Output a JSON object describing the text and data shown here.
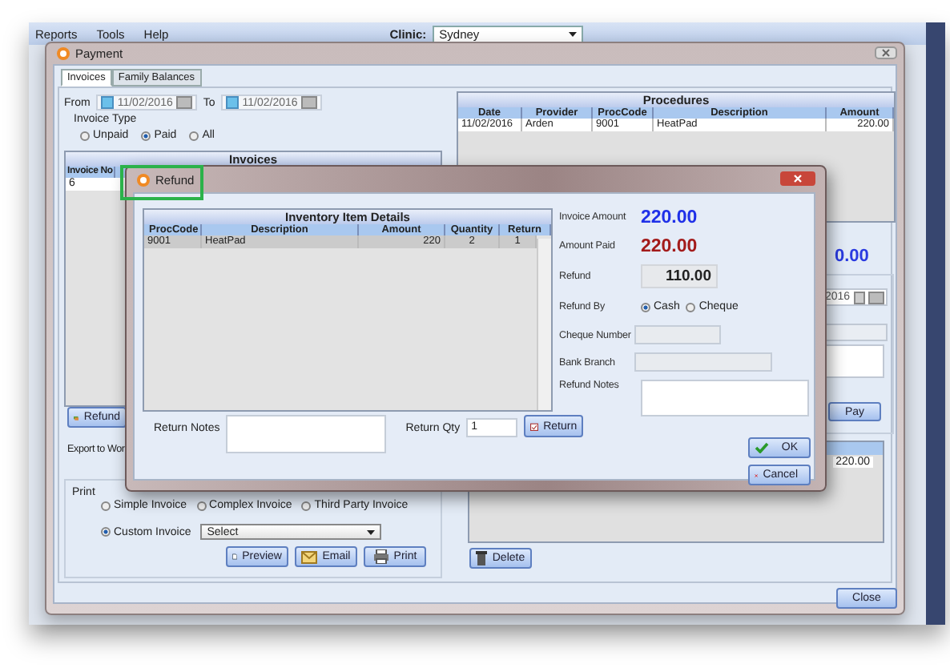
{
  "app": {
    "menu": [
      "Reports",
      "Tools",
      "Help"
    ],
    "clinic_label": "Clinic:",
    "clinic": "Sydney"
  },
  "payment": {
    "title": "Payment",
    "tabs": [
      {
        "label": "Invoices",
        "selected": true
      },
      {
        "label": "Family Balances",
        "selected": false
      }
    ],
    "from_label": "From",
    "from_date": "11/02/2016",
    "to_label": "To",
    "to_date": "11/02/2016",
    "invoice_type_label": "Invoice Type",
    "invoice_types": [
      {
        "label": "Unpaid",
        "selected": false
      },
      {
        "label": "Paid",
        "selected": true
      },
      {
        "label": "All",
        "selected": false
      }
    ],
    "invoices": {
      "title": "Invoices",
      "column": "Invoice No",
      "row": "6"
    },
    "refund_button": "Refund",
    "export_label": "Export to Wor",
    "print": {
      "label": "Print",
      "options": [
        {
          "label": "Simple Invoice",
          "selected": false
        },
        {
          "label": "Complex Invoice",
          "selected": false
        },
        {
          "label": "Third Party Invoice",
          "selected": false
        },
        {
          "label": "Custom Invoice",
          "selected": true
        }
      ],
      "template": "Select",
      "buttons": [
        "Preview",
        "Email",
        "Print"
      ]
    },
    "procedures": {
      "title": "Procedures",
      "columns": [
        "Date",
        "Provider",
        "ProcCode",
        "Description",
        "Amount"
      ],
      "rows": [
        [
          "11/02/2016",
          "Arden",
          "9001",
          "HeatPad",
          "220.00"
        ]
      ]
    },
    "balance_fragment": "0.00",
    "date_fragment": "2016",
    "pay_button": "Pay",
    "payments_amount": "220.00",
    "delete_button": "Delete",
    "close_button": "Close"
  },
  "refund": {
    "title": "Refund",
    "items": {
      "title": "Inventory Item Details",
      "columns": [
        "ProcCode",
        "Description",
        "Amount",
        "Quantity",
        "Return"
      ],
      "rows": [
        [
          "9001",
          "HeatPad",
          "220",
          "2",
          "1"
        ]
      ]
    },
    "return_notes_label": "Return Notes",
    "return_qty_label": "Return Qty",
    "return_qty": "1",
    "return_button": "Return",
    "invoice_amount_label": "Invoice Amount",
    "invoice_amount": "220.00",
    "amount_paid_label": "Amount Paid",
    "amount_paid": "220.00",
    "refund_label": "Refund",
    "refund_amount": "110.00",
    "refund_by_label": "Refund By",
    "refund_by": [
      {
        "label": "Cash",
        "selected": true
      },
      {
        "label": "Cheque",
        "selected": false
      }
    ],
    "cheque_number_label": "Cheque Number",
    "bank_branch_label": "Bank Branch",
    "refund_notes_label": "Refund Notes",
    "ok_button": "OK",
    "cancel_button": "Cancel"
  }
}
